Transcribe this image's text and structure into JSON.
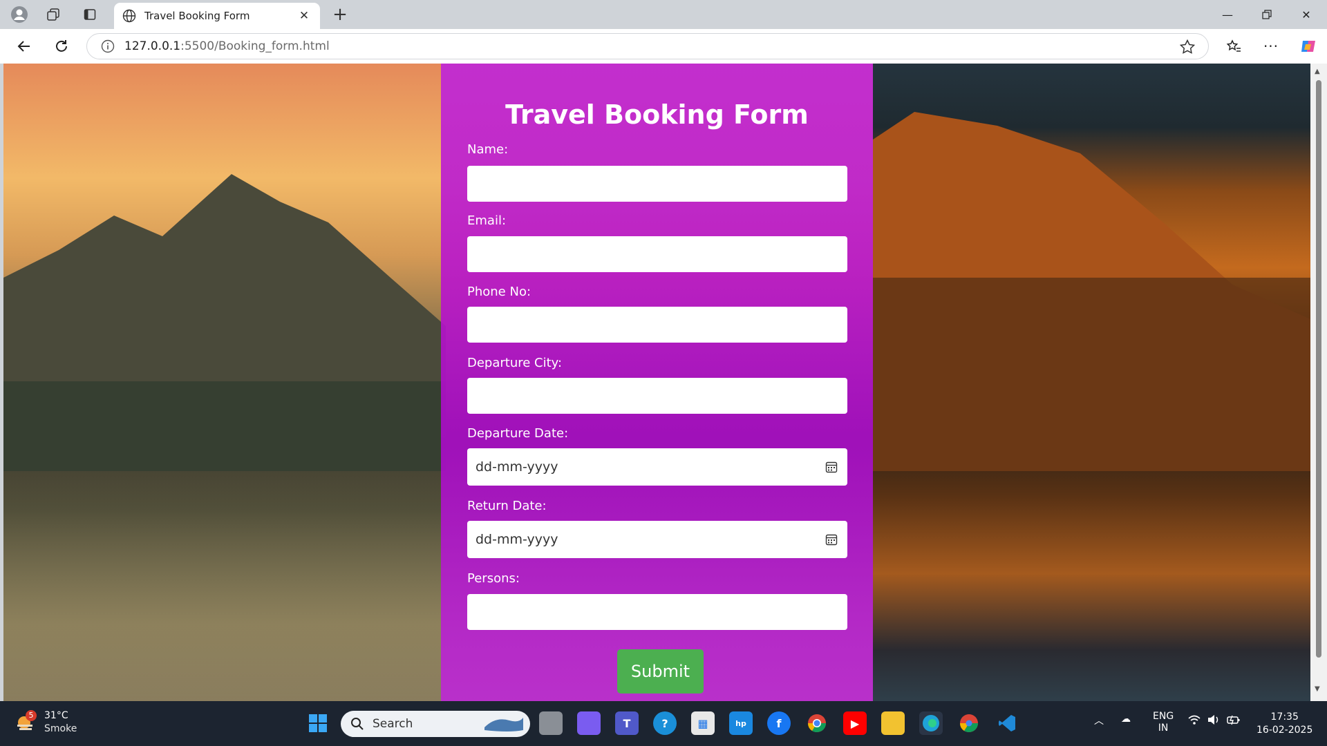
{
  "browser": {
    "tab_title": "Travel Booking Form",
    "url_host": "127.0.0.1",
    "url_rest": ":5500/Booking_form.html"
  },
  "form": {
    "title": "Travel Booking Form",
    "fields": [
      {
        "label": "Name:",
        "type": "text"
      },
      {
        "label": "Email:",
        "type": "text"
      },
      {
        "label": "Phone No:",
        "type": "text"
      },
      {
        "label": "Departure City:",
        "type": "text"
      },
      {
        "label": "Departure Date:",
        "type": "date",
        "placeholder": "dd-mm-yyyy"
      },
      {
        "label": "Return Date:",
        "type": "date",
        "placeholder": "dd-mm-yyyy"
      },
      {
        "label": "Persons:",
        "type": "text"
      }
    ],
    "submit_label": "Submit",
    "accent_color": "#b820cc",
    "submit_color": "#4caf50"
  },
  "taskbar": {
    "weather_badge": "5",
    "weather_temp": "31°C",
    "weather_condition": "Smoke",
    "search_placeholder": "Search",
    "language": "ENG",
    "region": "IN",
    "time": "17:35",
    "date": "16-02-2025"
  }
}
